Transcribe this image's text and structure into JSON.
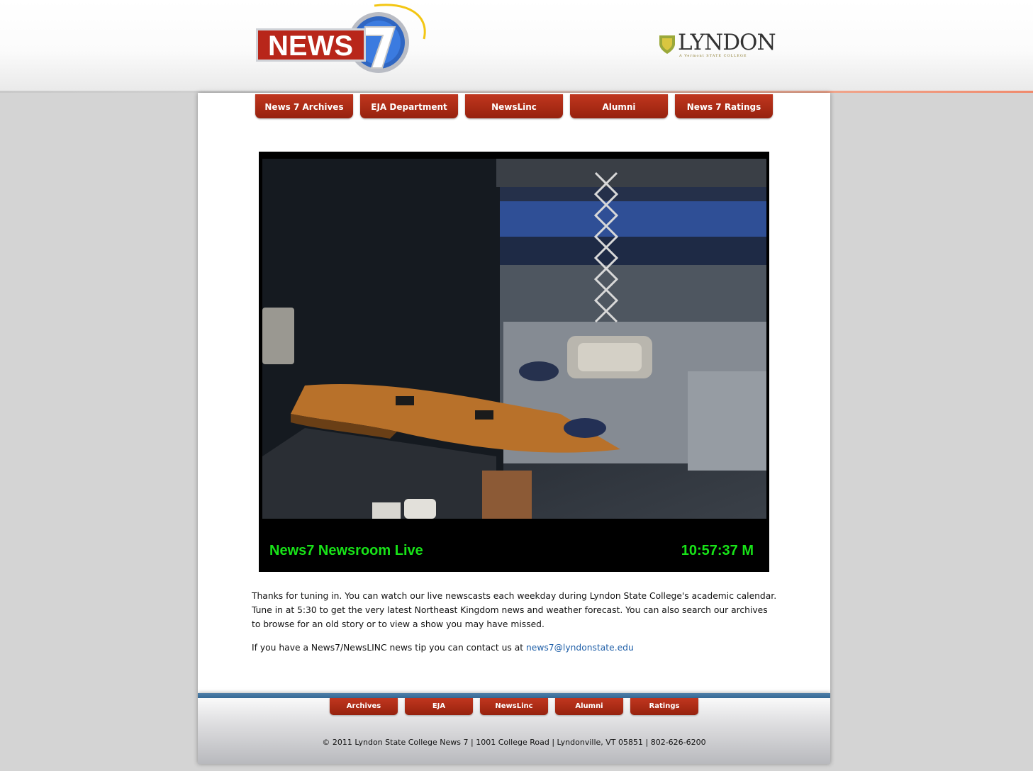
{
  "header": {
    "logo_text": "NEWS",
    "logo_number": "7",
    "partner_logo": "LYNDON",
    "partner_tagline": "A Vermont STATE COLLEGE"
  },
  "nav": [
    {
      "label": "News 7 Archives"
    },
    {
      "label": "EJA Department"
    },
    {
      "label": "NewsLinc"
    },
    {
      "label": "Alumni"
    },
    {
      "label": "News 7 Ratings"
    }
  ],
  "video": {
    "title": "News7 Newsroom Live",
    "time": "10:57:37 M"
  },
  "content": {
    "intro": "Thanks for tuning in. You can watch our live newscasts each weekday during Lyndon State College's academic calendar. Tune in at 5:30 to get the very latest Northeast Kingdom news and weather forecast. You can also search our archives to browse for an old story or to view a show you may have missed.",
    "tip_prefix": "If you have a News7/NewsLINC news tip you can contact us at ",
    "tip_email": "news7@lyndonstate.edu"
  },
  "footer": {
    "nav": [
      {
        "label": "Archives"
      },
      {
        "label": "EJA"
      },
      {
        "label": "NewsLinc"
      },
      {
        "label": "Alumni"
      },
      {
        "label": "Ratings"
      }
    ],
    "copyright": "© 2011 Lyndon State College News 7 | 1001 College Road | Lyndonville, VT 05851 | 802-626-6200"
  },
  "colors": {
    "nav_red": "#a82a14",
    "live_green": "#18e318",
    "link_blue": "#1f5fa8",
    "footer_bar": "#356a97"
  }
}
